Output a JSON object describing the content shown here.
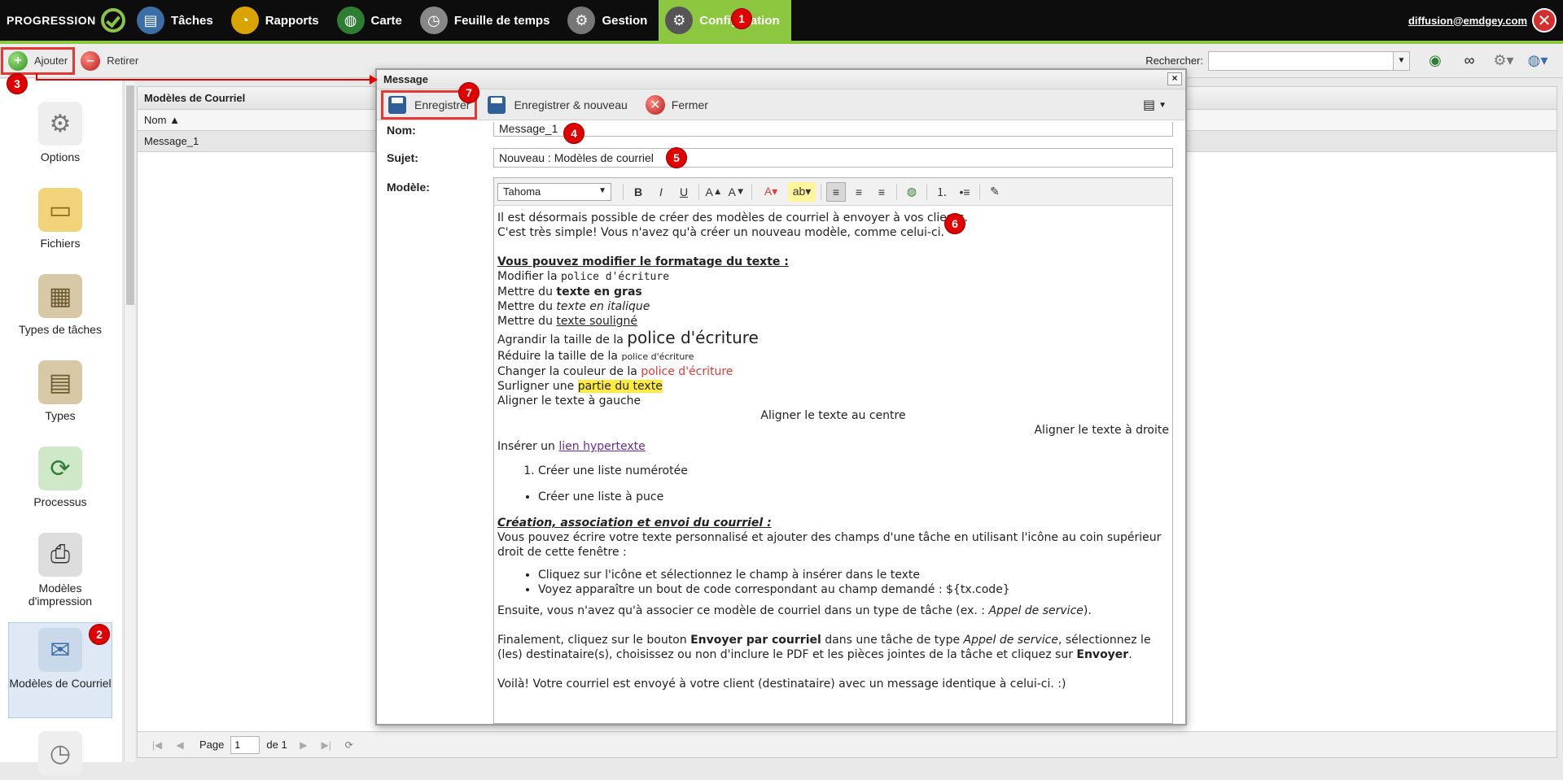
{
  "topbar": {
    "brand": "PROGRESSION",
    "nav": [
      {
        "label": "Tâches",
        "icon": "tasks-icon",
        "color": "#3a6ea5"
      },
      {
        "label": "Rapports",
        "icon": "reports-icon",
        "color": "#d9a300"
      },
      {
        "label": "Carte",
        "icon": "map-icon",
        "color": "#2e7d32"
      },
      {
        "label": "Feuille de temps",
        "icon": "clock-icon",
        "color": "#888888"
      },
      {
        "label": "Gestion",
        "icon": "gears-icon",
        "color": "#777777"
      },
      {
        "label": "Configuration",
        "icon": "config-gears-icon",
        "color": "#555555"
      }
    ],
    "user_email": "diffusion@emdgey.com",
    "active_color": "#8dc63f"
  },
  "toolbar": {
    "add_label": "Ajouter",
    "remove_label": "Retirer",
    "search_label": "Rechercher:",
    "search_value": ""
  },
  "sidebar": {
    "items": [
      {
        "label": "Options",
        "icon": "gear-icon"
      },
      {
        "label": "Fichiers",
        "icon": "folder-icon"
      },
      {
        "label": "Types de tâches",
        "icon": "clipboard-gear-icon"
      },
      {
        "label": "Types",
        "icon": "clipboard-icon"
      },
      {
        "label": "Processus",
        "icon": "process-arrows-icon"
      },
      {
        "label": "Modèles d'impression",
        "icon": "printer-icon"
      },
      {
        "label": "Modèles de Courriel",
        "icon": "email-template-icon"
      }
    ]
  },
  "grid": {
    "title": "Modèles de Courriel",
    "column": "Nom",
    "rows": [
      "Message_1"
    ],
    "pager": {
      "page_label": "Page",
      "page_value": "1",
      "of_label": "de 1"
    }
  },
  "modal": {
    "title": "Message",
    "close": "×",
    "save_label": "Enregistrer",
    "save_new_label": "Enregistrer & nouveau",
    "close_label": "Fermer",
    "name_label": "Nom:",
    "name_value": "Message_1",
    "subject_label": "Sujet:",
    "subject_value": "Nouveau : Modèles de courriel",
    "template_label": "Modèle:",
    "font_value": "Tahoma"
  },
  "editor": {
    "l1": "Il est désormais possible de créer des modèles de courriel à envoyer à vos clients.",
    "l2": "C'est très simple! Vous n'avez qu'à créer un nouveau modèle, comme celui-ci.",
    "h1": "Vous pouvez modifier le formatage du texte :",
    "f1a": "Modifier la ",
    "f1b": "police d'écriture",
    "f2a": "Mettre du ",
    "f2b": "texte en gras",
    "f3a": "Mettre du ",
    "f3b": "texte en italique",
    "f4a": "Mettre du ",
    "f4b": "texte souligné",
    "f5a": "Agrandir la taille de la ",
    "f5b": "police d'écriture",
    "f6a": "Réduire la taille de la ",
    "f6b": "police d'écriture",
    "f7a": "Changer la couleur de la ",
    "f7b": "police d'écriture",
    "f8a": "Surligner une ",
    "f8b": "partie du texte",
    "f9": "Aligner le texte à gauche",
    "f10": "Aligner le texte au centre",
    "f11": "Aligner le texte à droite",
    "f12a": "Insérer un ",
    "f12b": "lien hypertexte",
    "ol1": "Créer une liste numérotée",
    "ul1": "Créer une liste à puce",
    "h2": "Création, association et envoi du courriel :",
    "p1": "Vous pouvez écrire votre texte personnalisé et ajouter des champs d'une tâche en utilisant l'icône au coin supérieur droit de cette fenêtre :",
    "b1": "Cliquez sur l'icône et sélectionnez le champ à insérer dans le texte",
    "b2": "Voyez apparaître un bout de code correspondant au champ demandé : ${tx.code}",
    "p2a": "Ensuite, vous n'avez qu'à associer ce modèle de courriel dans un type de tâche (ex. : ",
    "p2b": "Appel de service",
    "p2c": ").",
    "p3a": "Finalement, cliquez sur le bouton ",
    "p3b": "Envoyer par courriel",
    "p3c": " dans une tâche de type ",
    "p3d": "Appel de service",
    "p3e": ", sélectionnez le (les) destinataire(s), choisissez ou non d'inclure le PDF et les pièces jointes de la tâche et cliquez sur ",
    "p3f": "Envoyer",
    "p3g": ".",
    "p4": "Voilà! Votre courriel est envoyé à votre client (destinataire) avec un message identique à celui-ci. :)"
  },
  "badges": [
    "1",
    "2",
    "3",
    "4",
    "5",
    "6",
    "7"
  ],
  "colors": {
    "highlight": "#e53935",
    "badge": "#e10000",
    "link": "#6a2a9a"
  }
}
